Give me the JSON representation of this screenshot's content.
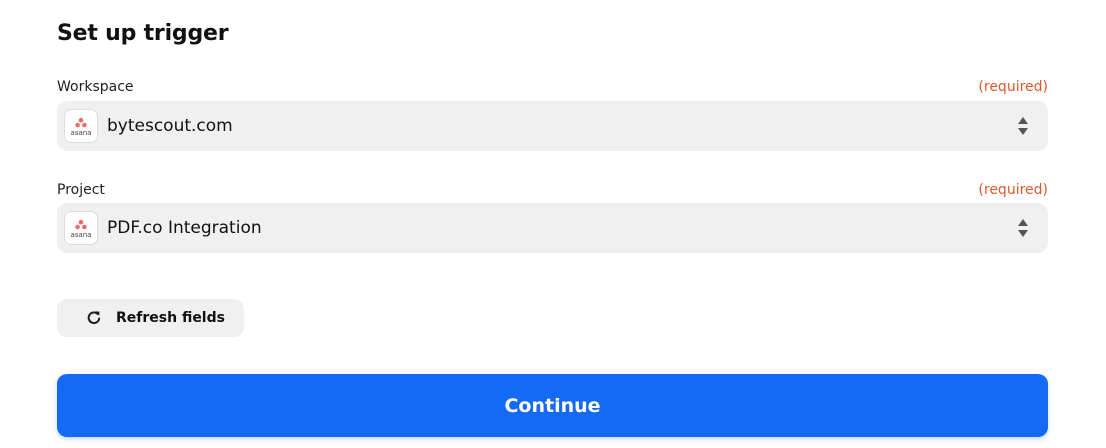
{
  "header": {
    "title": "Set up trigger"
  },
  "fields": [
    {
      "label": "Workspace",
      "required_text": "(required)",
      "value": "bytescout.com",
      "icon": "asana-logo-icon",
      "logo_text": "asana"
    },
    {
      "label": "Project",
      "required_text": "(required)",
      "value": "PDF.co Integration",
      "icon": "asana-logo-icon",
      "logo_text": "asana"
    }
  ],
  "actions": {
    "refresh_label": "Refresh fields",
    "refresh_icon": "refresh-icon",
    "continue_label": "Continue"
  },
  "colors": {
    "required": "#e0582c",
    "primary_button": "#1469f5",
    "field_background": "#f0f0f0",
    "asana_brand": "#f06a6a"
  }
}
